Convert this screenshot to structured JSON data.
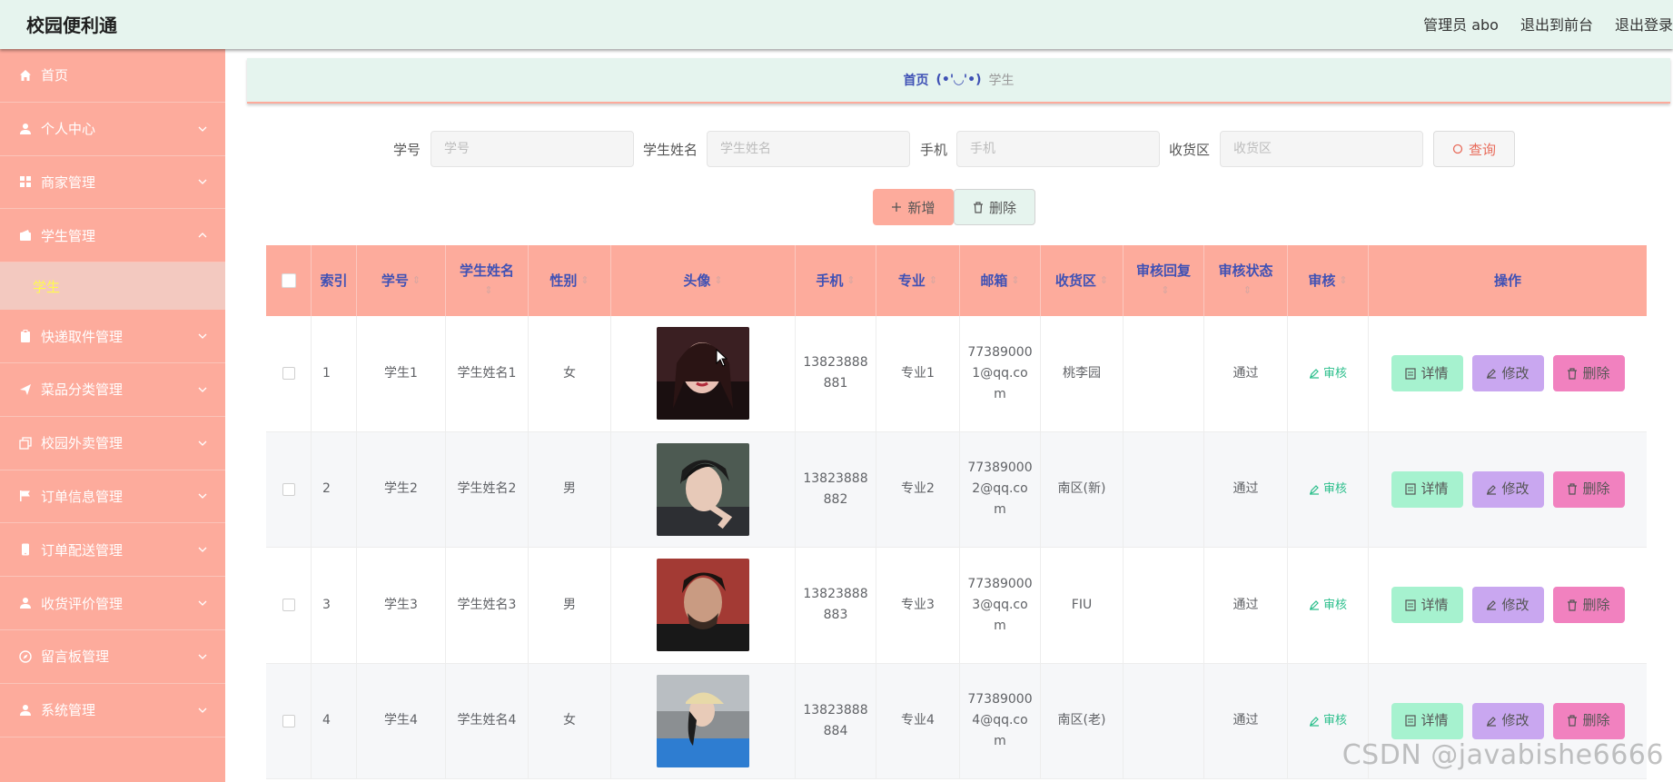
{
  "header": {
    "brand": "校园便利通",
    "admin": "管理员 abo",
    "to_front": "退出到前台",
    "logout": "退出登录"
  },
  "sidebar": {
    "items": [
      {
        "label": "首页",
        "icon": "home-icon"
      },
      {
        "label": "个人中心",
        "icon": "user-icon"
      },
      {
        "label": "商家管理",
        "icon": "grid-icon"
      },
      {
        "label": "学生管理",
        "icon": "wallet-icon"
      },
      {
        "label": "快递取件管理",
        "icon": "clipboard-icon"
      },
      {
        "label": "菜品分类管理",
        "icon": "send-icon"
      },
      {
        "label": "校园外卖管理",
        "icon": "copy-icon"
      },
      {
        "label": "订单信息管理",
        "icon": "flag-icon"
      },
      {
        "label": "订单配送管理",
        "icon": "mobile-icon"
      },
      {
        "label": "收货评价管理",
        "icon": "user-icon"
      },
      {
        "label": "留言板管理",
        "icon": "compass-icon"
      },
      {
        "label": "系统管理",
        "icon": "user-icon"
      }
    ],
    "submenu_active": "学生"
  },
  "breadcrumb": {
    "home": "首页",
    "face": "(•'◡'•)",
    "current": "学生"
  },
  "search": {
    "fields": [
      {
        "label": "学号",
        "placeholder": "学号"
      },
      {
        "label": "学生姓名",
        "placeholder": "学生姓名"
      },
      {
        "label": "手机",
        "placeholder": "手机"
      },
      {
        "label": "收货区",
        "placeholder": "收货区"
      }
    ],
    "query_label": "查询"
  },
  "actions": {
    "add_label": "新增",
    "delete_label": "删除"
  },
  "table": {
    "headers": [
      "索引",
      "学号",
      "学生姓名",
      "性别",
      "头像",
      "手机",
      "专业",
      "邮箱",
      "收货区",
      "审核回复",
      "审核状态",
      "审核",
      "操作"
    ],
    "rows": [
      {
        "index": "1",
        "sid": "学生1",
        "name": "学生姓名1",
        "gender": "女",
        "phone_a": "13823888",
        "phone_b": "881",
        "major": "专业1",
        "email_a": "77389000",
        "email_b": "1@qq.co",
        "email_c": "m",
        "area": "桃李园",
        "reply": "",
        "status": "通过",
        "audit": "审核"
      },
      {
        "index": "2",
        "sid": "学生2",
        "name": "学生姓名2",
        "gender": "男",
        "phone_a": "13823888",
        "phone_b": "882",
        "major": "专业2",
        "email_a": "77389000",
        "email_b": "2@qq.co",
        "email_c": "m",
        "area": "南区(新)",
        "reply": "",
        "status": "通过",
        "audit": "审核"
      },
      {
        "index": "3",
        "sid": "学生3",
        "name": "学生姓名3",
        "gender": "男",
        "phone_a": "13823888",
        "phone_b": "883",
        "major": "专业3",
        "email_a": "77389000",
        "email_b": "3@qq.co",
        "email_c": "m",
        "area": "FIU",
        "reply": "",
        "status": "通过",
        "audit": "审核"
      },
      {
        "index": "4",
        "sid": "学生4",
        "name": "学生姓名4",
        "gender": "女",
        "phone_a": "13823888",
        "phone_b": "884",
        "major": "专业4",
        "email_a": "77389000",
        "email_b": "4@qq.co",
        "email_c": "m",
        "area": "南区(老)",
        "reply": "",
        "status": "通过",
        "audit": "审核"
      }
    ],
    "row_actions": {
      "detail": "详情",
      "edit": "修改",
      "remove": "删除"
    }
  },
  "watermark": "CSDN @javabishe6666",
  "colors": {
    "sidebar": "#fdab9c",
    "header": "#e6f4ee",
    "accent_text": "#3f51b5",
    "detail_btn": "#a6f2cf",
    "edit_btn": "#c9a7f0",
    "remove_btn": "#f181bf"
  }
}
